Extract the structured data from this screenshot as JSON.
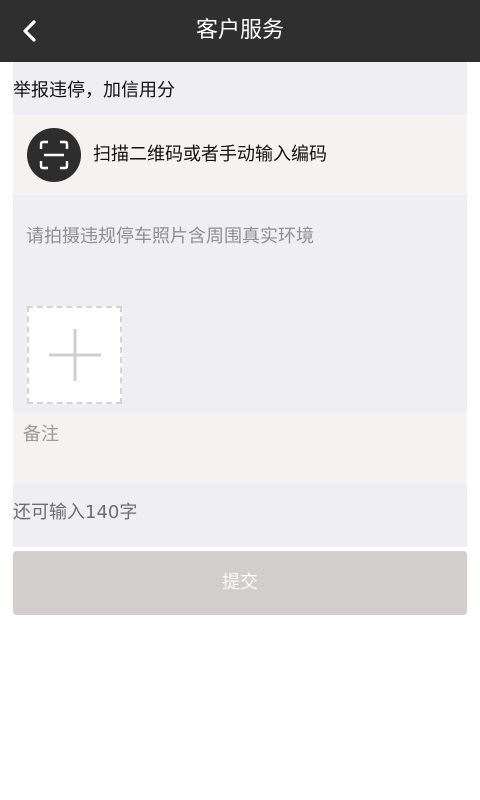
{
  "header": {
    "title": "客户服务",
    "back_icon": "chevron-left-icon"
  },
  "form": {
    "section_title": "举报违停，加信用分",
    "scan": {
      "icon": "scan-qr-icon",
      "label": "扫描二维码或者手动输入编码"
    },
    "photo_hint": "请拍摄违规停车照片含周围真实环境",
    "add_photo_icon": "plus-icon",
    "remark_placeholder": "备注",
    "remark_value": "",
    "counter": "还可输入140字"
  },
  "submit": {
    "label": "提交"
  },
  "colors": {
    "header_bg": "#2f2f2f",
    "content_bg": "#efeff3",
    "row_bg": "#f4f3f1",
    "submit_bg": "#d1cecb"
  }
}
